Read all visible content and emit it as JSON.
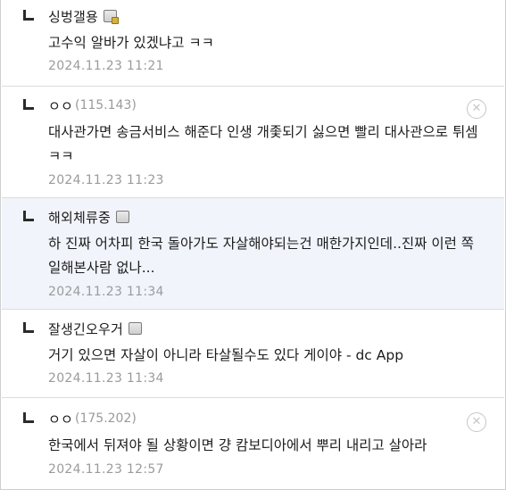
{
  "comments": [
    {
      "nick": "싱벙갤용",
      "ip": "",
      "text": "고수익 알바가 있겠냐고 ㅋㅋ",
      "date": "2024.11.23 11:21"
    },
    {
      "nick": "ㅇㅇ",
      "ip": "(115.143)",
      "text": "대사관가면 송금서비스 해준다 인생 개좇되기 싫으면 빨리 대사관으로 튀셈 ㅋㅋ",
      "date": "2024.11.23 11:23",
      "delete_glyph": "✕"
    },
    {
      "nick": "해외체류중",
      "ip": "",
      "text": "하 진짜 어차피 한국 돌아가도 자살해야되는건 매한가지인데..진짜 이런 쪽 일해본사람 없나...",
      "date": "2024.11.23 11:34"
    },
    {
      "nick": "잘생긴오우거",
      "ip": "",
      "text": "거기 있으면 자살이 아니라 타살될수도 있다 게이야 - dc App",
      "date": "2024.11.23 11:34"
    },
    {
      "nick": "ㅇㅇ",
      "ip": "(175.202)",
      "text": "한국에서 뒤져야 될 상황이면 걍 캄보디아에서 뿌리 내리고 살아라",
      "date": "2024.11.23 12:57",
      "delete_glyph": "✕"
    }
  ],
  "colors": {
    "highlight_bg": "#f1f4fb",
    "date": "#9b9b9b",
    "ip": "#9a9a9a",
    "divider": "#dcdcdc"
  },
  "icons": [
    "reply-arrow-icon",
    "gallog-icon",
    "delete-icon"
  ]
}
